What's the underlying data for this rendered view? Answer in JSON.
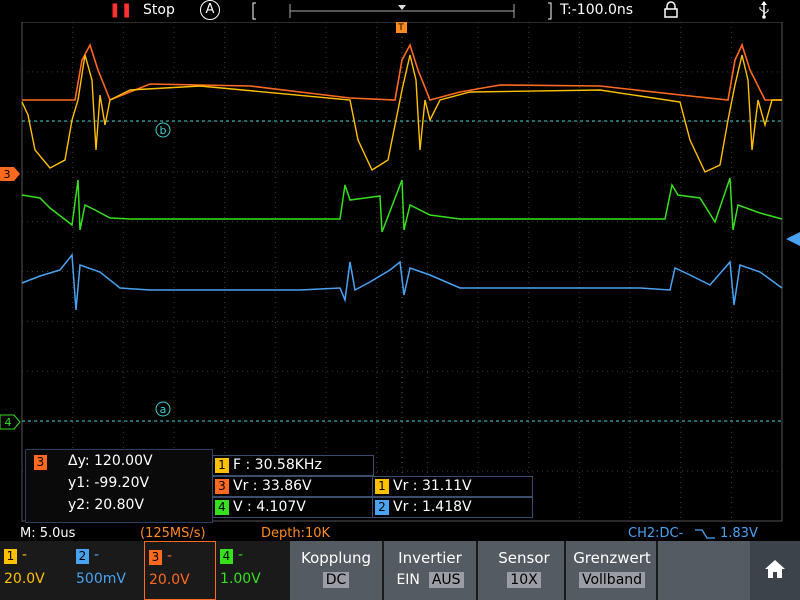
{
  "top": {
    "run_state": "Stop",
    "trigger_mode": "A",
    "time_offset": "T:-100.0ns"
  },
  "markers": {
    "cursor_a": "a",
    "cursor_b": "b",
    "ch3_marker": "3",
    "ch4_marker": "4",
    "trigger_marker": "T"
  },
  "cursor_panel": {
    "channel": "3",
    "dy": "Δy: 120.00V",
    "y1": "y1: -99.20V",
    "y2": "y2: 20.80V"
  },
  "measurements": [
    {
      "channel": "1",
      "text": "F : 30.58KHz"
    },
    {
      "channel": "3",
      "text": "Vr : 33.86V"
    },
    {
      "channel": "1",
      "text": "Vr : 31.11V"
    },
    {
      "channel": "4",
      "text": "V : 4.107V"
    },
    {
      "channel": "2",
      "text": "Vr : 1.418V"
    }
  ],
  "status": {
    "timebase": "M: 5.0us",
    "sample_rate": "(125MS/s)",
    "depth": "Depth:10K",
    "trigger": "CH2:DC-",
    "trigger_level": "1.83V"
  },
  "channels": [
    {
      "num": "1",
      "dash": "-",
      "value": "20.0V",
      "color": "#ffc000"
    },
    {
      "num": "2",
      "dash": "-",
      "value": "500mV",
      "color": "#4aa3f2"
    },
    {
      "num": "3",
      "dash": "-",
      "value": "20.0V",
      "color": "#ff6a20"
    },
    {
      "num": "4",
      "dash": "-",
      "value": "1.00V",
      "color": "#36e01c"
    }
  ],
  "menu": [
    {
      "label": "Kopplung",
      "value": "DC"
    },
    {
      "label": "Invertier",
      "value_on": "EIN",
      "value_off": "AUS"
    },
    {
      "label": "Sensor",
      "value": "10X"
    },
    {
      "label": "Grenzwert",
      "value": "Vollband"
    }
  ],
  "icons": {
    "run": "pause-bars-icon",
    "lock": "lock-icon",
    "usb": "usb-icon",
    "home": "home-icon"
  },
  "colors": {
    "ch1": "#ffc000",
    "ch2": "#4aa3f2",
    "ch3": "#ff6a20",
    "ch4": "#36e01c",
    "cursor": "#3fd0d0",
    "grid": "#3a3a3a"
  }
}
